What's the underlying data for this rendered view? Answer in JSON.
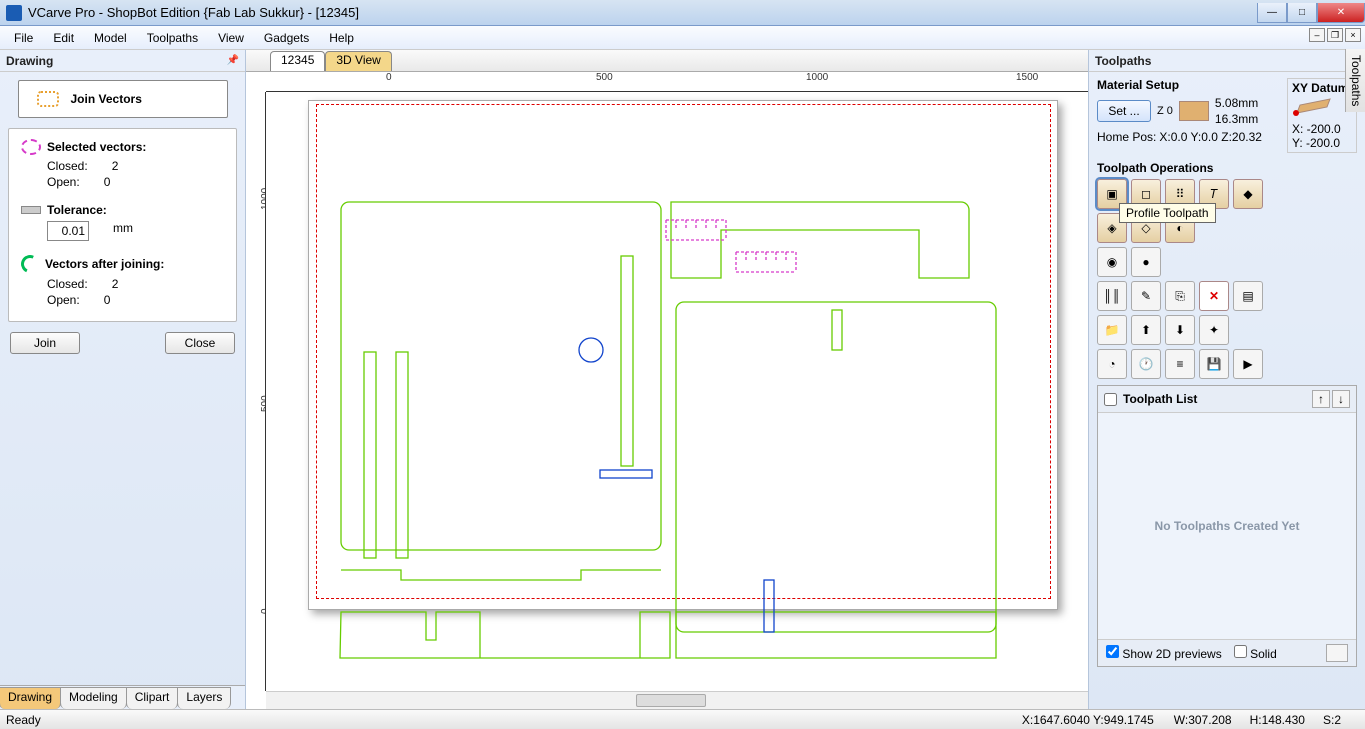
{
  "title": "VCarve Pro - ShopBot Edition {Fab Lab Sukkur} - [12345]",
  "menu": {
    "file": "File",
    "edit": "Edit",
    "model": "Model",
    "toolpaths": "Toolpaths",
    "view": "View",
    "gadgets": "Gadgets",
    "help": "Help"
  },
  "left": {
    "title": "Drawing",
    "join_btn": "Join Vectors",
    "selected": {
      "label": "Selected vectors:",
      "closed_l": "Closed:",
      "closed_v": "2",
      "open_l": "Open:",
      "open_v": "0"
    },
    "tol": {
      "label": "Tolerance:",
      "value": "0.01",
      "unit": "mm"
    },
    "after": {
      "label": "Vectors after joining:",
      "closed_l": "Closed:",
      "closed_v": "2",
      "open_l": "Open:",
      "open_v": "0"
    },
    "btn_join": "Join",
    "btn_close": "Close",
    "tabs": {
      "drawing": "Drawing",
      "modeling": "Modeling",
      "clipart": "Clipart",
      "layers": "Layers"
    }
  },
  "center": {
    "tab1": "12345",
    "tab2": "3D View",
    "ruler_h": [
      "0",
      "500",
      "1000",
      "1500"
    ],
    "ruler_v": [
      "0",
      "500",
      "1000"
    ]
  },
  "right": {
    "title": "Toolpaths",
    "material": {
      "h": "Material Setup",
      "set": "Set ...",
      "z0": "Z 0",
      "d1": "5.08mm",
      "d2": "16.3mm",
      "home": "Home Pos:",
      "homev": "X:0.0 Y:0.0 Z:20.32"
    },
    "xy": {
      "h": "XY Datum",
      "x": "X:  -200.0",
      "y": "Y:  -200.0"
    },
    "ops_h": "Toolpath Operations",
    "tooltip": "Profile Toolpath",
    "list_h": "Toolpath List",
    "empty": "No Toolpaths Created Yet",
    "show2d": "Show 2D previews",
    "solid": "Solid",
    "vtab": "Toolpaths"
  },
  "status": {
    "ready": "Ready",
    "xy": "X:1647.6040 Y:949.1745",
    "w": "W:307.208",
    "h": "H:148.430",
    "s": "S:2"
  }
}
